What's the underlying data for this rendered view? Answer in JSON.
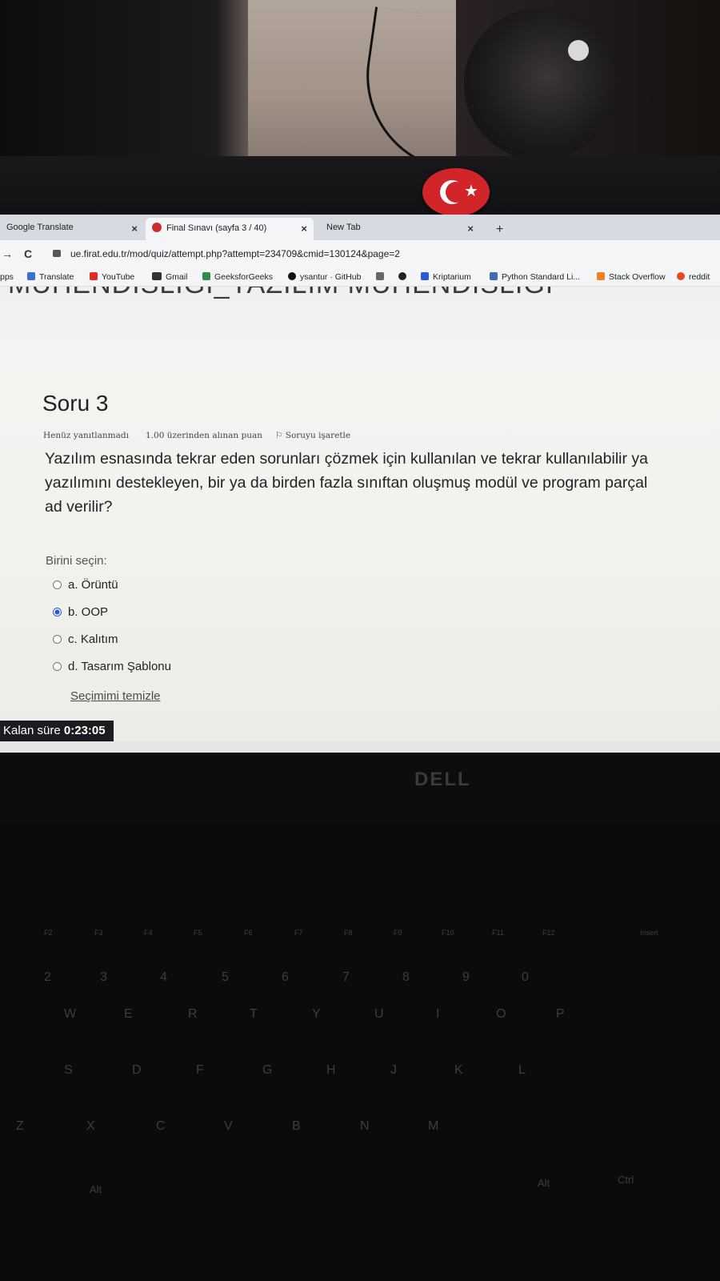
{
  "browser": {
    "tabs": [
      {
        "label": "Google Translate",
        "active": false
      },
      {
        "label": "Final Sınavı (sayfa 3 / 40)",
        "active": true
      },
      {
        "label": "New Tab",
        "active": false
      }
    ],
    "url": "ue.firat.edu.tr/mod/quiz/attempt.php?attempt=234709&cmid=130124&page=2",
    "bookmarks": [
      {
        "label": "pps"
      },
      {
        "label": "Translate"
      },
      {
        "label": "YouTube"
      },
      {
        "label": "Gmail"
      },
      {
        "label": "GeeksforGeeks"
      },
      {
        "label": "ysantur · GitHub"
      },
      {
        "label": "Kriptarium"
      },
      {
        "label": "Python Standard Li..."
      },
      {
        "label": "Stack Overflow"
      },
      {
        "label": "reddit"
      }
    ]
  },
  "page": {
    "course_title": "MÜHENDİSLİĞİ_YAZILIM MÜHENDİSLİĞİ",
    "question_title": "Soru 3",
    "status": "Henüz yanıtlanmadı",
    "points": "1.00 üzerinden alınan puan",
    "flag_label": "Soruyu işaretle",
    "question_text": "Yazılım esnasında tekrar eden sorunları çözmek için kullanılan ve tekrar kullanılabilir ya\nyazılımını destekleyen, bir ya da birden fazla sınıftan oluşmuş modül ve program parçal\nad verilir?",
    "choose_label": "Birini seçin:",
    "options": [
      {
        "label": "a. Örüntü",
        "selected": false
      },
      {
        "label": "b. OOP",
        "selected": true
      },
      {
        "label": "c. Kalıtım",
        "selected": false
      },
      {
        "label": "d. Tasarım Şablonu",
        "selected": false
      }
    ],
    "clear_label": "Seçimimi temizle",
    "timer_label": "Kalan süre",
    "timer_value": "0:23:05"
  },
  "hardware": {
    "brand": "DELL"
  },
  "colors": {
    "accent": "#2a5ad8",
    "timer_bg": "#1a1c20",
    "flag_red": "#d1252a"
  }
}
